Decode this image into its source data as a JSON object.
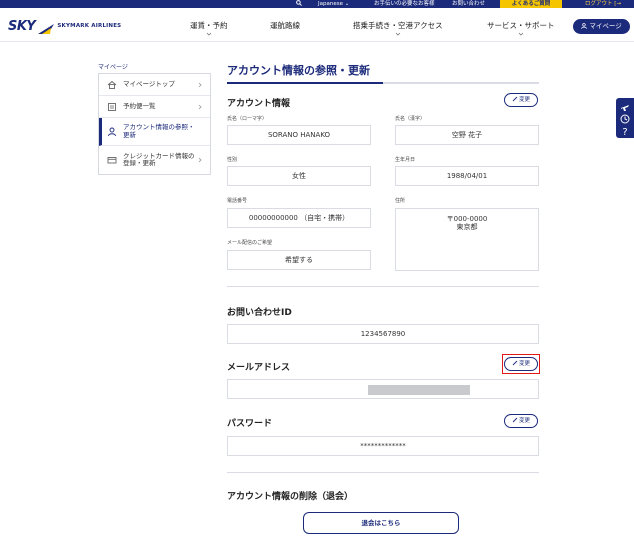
{
  "topbar": {
    "language": "Japanese",
    "guide": "お手伝いの必要なお客様",
    "contact": "お問い合わせ",
    "faq": "よくあるご質問",
    "logout": "ログアウト"
  },
  "header": {
    "logo_sky": "SKY",
    "logo_airlines": "SKYMARK AIRLINES",
    "nav": {
      "fare": "運賃・予約",
      "route": "運航路線",
      "boarding": "搭乗手続き・空港アクセス",
      "service": "サービス・サポート"
    },
    "mypage": "マイページ"
  },
  "sidebar": {
    "title": "マイページ",
    "items": [
      {
        "label": "マイページトップ"
      },
      {
        "label": "予約便一覧"
      },
      {
        "label": "アカウント情報の参照・更新"
      },
      {
        "label": "クレジットカード情報の登録・更新"
      }
    ]
  },
  "main": {
    "page_title": "アカウント情報の参照・更新",
    "edit_label": "変更",
    "account": {
      "title": "アカウント情報",
      "name_roman_label": "氏名（ローマ字）",
      "name_roman": "SORANO HANAKO",
      "name_kanji_label": "氏名（漢字）",
      "name_kanji": "空野 花子",
      "gender_label": "性別",
      "gender": "女性",
      "birthdate_label": "生年月日",
      "birthdate": "1988/04/01",
      "phone_label": "電話番号",
      "phone": "00000000000 （自宅・携帯）",
      "address_label": "住所",
      "postal": "〒000-0000",
      "prefecture": "東京都",
      "mail_pref_label": "メール配信のご希望",
      "mail_pref": "希望する"
    },
    "inquiry": {
      "title": "お問い合わせID",
      "value": "1234567890"
    },
    "email": {
      "title": "メールアドレス"
    },
    "password": {
      "title": "パスワード",
      "value": "*************"
    },
    "delete": {
      "title": "アカウント情報の削除（退会）",
      "button": "退会はこちら"
    }
  },
  "colors": {
    "brand_navy": "#1b2a7a",
    "brand_yellow": "#f5c500",
    "highlight_red": "#e01a1a"
  }
}
